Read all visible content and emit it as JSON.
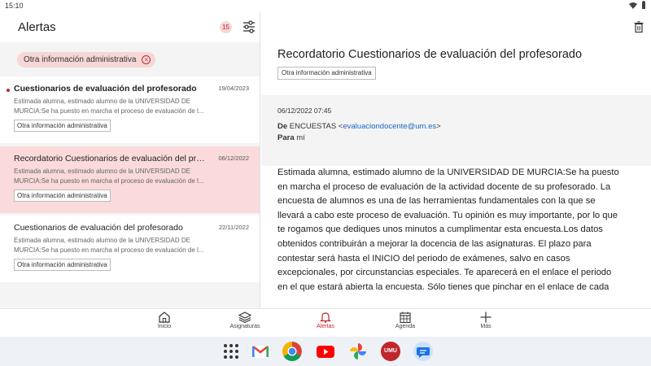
{
  "status_bar": {
    "time": "15:10"
  },
  "header": {
    "title": "Alertas",
    "unread_count": "15"
  },
  "filter": {
    "chip_label": "Otra información administrativa",
    "chip_close": "×"
  },
  "messages": [
    {
      "subject": "Cuestionarios de evaluación del profesorado",
      "date": "19/04/2023",
      "preview": "Estimada alumna, estimado alumno de la UNIVERSIDAD DE MURCIA:Se ha puesto en marcha el proceso de evaluación de l...",
      "tag": "Otra información administrativa",
      "unread": true,
      "selected": false
    },
    {
      "subject": "Recordatorio Cuestionarios de evaluación del profesorado",
      "date": "06/12/2022",
      "preview": "Estimada alumna, estimado alumno de la UNIVERSIDAD DE MURCIA:Se ha puesto en marcha el proceso de evaluación de l...",
      "tag": "Otra información administrativa",
      "unread": false,
      "selected": true
    },
    {
      "subject": "Cuestionarios de evaluación del profesorado",
      "date": "22/11/2022",
      "preview": "Estimada alumna, estimado alumno de la UNIVERSIDAD DE MURCIA:Se ha puesto en marcha el proceso de evaluación de l...",
      "tag": "Otra información administrativa",
      "unread": false,
      "selected": false
    }
  ],
  "detail": {
    "title": "Recordatorio Cuestionarios de evaluación del profesorado",
    "tag": "Otra información administrativa",
    "datetime": "06/12/2022 07:45",
    "from_label": "De",
    "from_name": "ENCUESTAS <",
    "from_email": "evaluaciondocente@um.es",
    "from_close": ">",
    "to_label": "Para",
    "to_value": "mí",
    "body": "Estimada alumna, estimado alumno de la UNIVERSIDAD DE MURCIA:Se ha puesto en marcha el proceso de evaluación de la actividad docente de su profesorado. La encuesta de alumnos es una de las herramientas fundamentales con la que se llevará a cabo este proceso de evaluación. Tu opinión es muy importante, por lo que te rogamos que dediques unos minutos a cumplimentar esta encuesta.Los datos obtenidos contribuirán a mejorar la docencia de las asignaturas. El plazo para contestar será hasta el INICIO del periodo de exámenes, salvo en casos excepcionales, por circunstancias especiales. Te aparecerá en el enlace el periodo en el que estará abierta la encuesta. Sólo tienes que pinchar en el enlace de cada"
  },
  "nav": [
    {
      "label": "Inicio",
      "icon": "home-icon"
    },
    {
      "label": "Asignaturas",
      "icon": "layers-icon"
    },
    {
      "label": "Alertas",
      "icon": "bell-icon",
      "active": true
    },
    {
      "label": "Agenda",
      "icon": "calendar-icon"
    },
    {
      "label": "Más",
      "icon": "plus-icon"
    }
  ],
  "dock": {
    "umu_label": "UMU",
    "apps": [
      "app-drawer-icon",
      "gmail-icon",
      "chrome-icon",
      "youtube-icon",
      "photos-icon",
      "umu-app-icon",
      "messages-icon"
    ]
  },
  "colors": {
    "accent": "#c0272d",
    "selected_row": "#fadada",
    "chip_bg": "#f7d6d6",
    "link": "#1a66c9"
  }
}
